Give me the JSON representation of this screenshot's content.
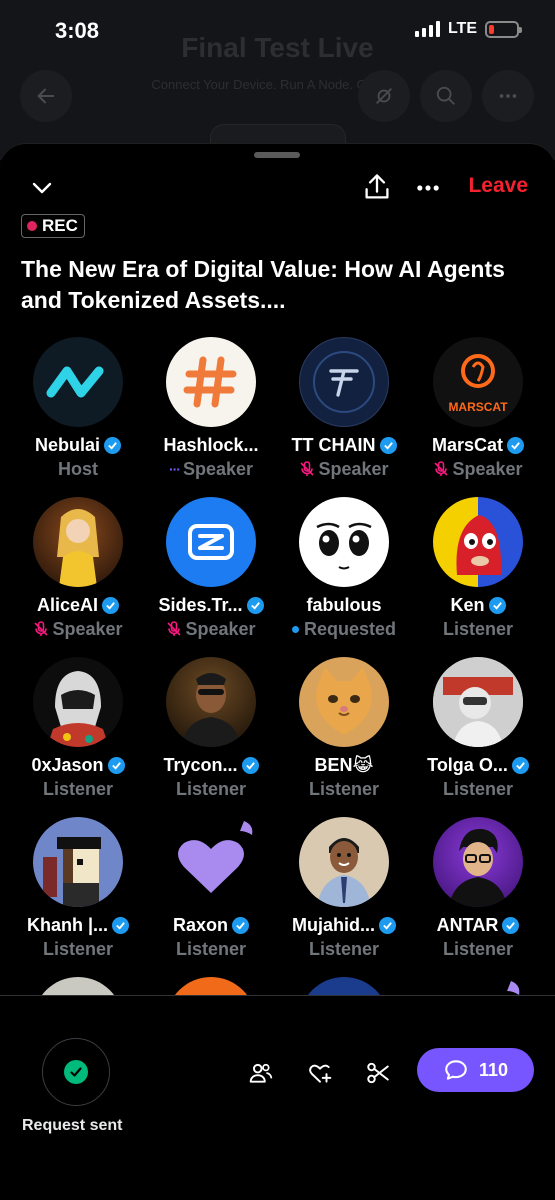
{
  "status_bar": {
    "time": "3:08",
    "network": "LTE"
  },
  "background": {
    "title": "Final Test Live",
    "subtitle": "Connect Your Device. Run A Node. Go ..ard"
  },
  "sheet": {
    "leave_label": "Leave",
    "rec_label": "REC",
    "title": "The New Era of Digital Value: How AI Agents and Tokenized Assets....",
    "participants": [
      {
        "name": "Nebulai",
        "role": "Host",
        "verified": true,
        "mic": "none"
      },
      {
        "name": "Hashlock...",
        "role": "Speaker",
        "verified": false,
        "mic": "speaking"
      },
      {
        "name": "TT CHAIN",
        "role": "Speaker",
        "verified": true,
        "mic": "muted"
      },
      {
        "name": "MarsCat",
        "role": "Speaker",
        "verified": true,
        "mic": "muted"
      },
      {
        "name": "AliceAI",
        "role": "Speaker",
        "verified": true,
        "mic": "muted"
      },
      {
        "name": "Sides.Tr...",
        "role": "Speaker",
        "verified": true,
        "mic": "muted"
      },
      {
        "name": "fabulous",
        "role": "Requested",
        "verified": false,
        "mic": "requested"
      },
      {
        "name": "Ken",
        "role": "Listener",
        "verified": true,
        "mic": "none"
      },
      {
        "name": "0xJason",
        "role": "Listener",
        "verified": true,
        "mic": "none"
      },
      {
        "name": "Trycon...",
        "role": "Listener",
        "verified": true,
        "mic": "none"
      },
      {
        "name": "BEN😹",
        "role": "Listener",
        "verified": false,
        "mic": "none"
      },
      {
        "name": "Tolga O...",
        "role": "Listener",
        "verified": true,
        "mic": "none"
      },
      {
        "name": "Khanh |...",
        "role": "Listener",
        "verified": true,
        "mic": "none"
      },
      {
        "name": "Raxon",
        "role": "Listener",
        "verified": true,
        "mic": "none"
      },
      {
        "name": "Mujahid...",
        "role": "Listener",
        "verified": true,
        "mic": "none"
      },
      {
        "name": "ANTAR",
        "role": "Listener",
        "verified": true,
        "mic": "none"
      }
    ]
  },
  "footer": {
    "request_label": "Request sent",
    "comment_count": "110"
  },
  "colors": {
    "accent": "#7856ff",
    "leave": "#f4212e",
    "verified": "#1d9bf0",
    "check": "#00ba7c"
  },
  "icons": [
    "chevron-down-icon",
    "share-icon",
    "more-icon",
    "verified-icon",
    "mic-off-icon",
    "checkmark-icon",
    "people-icon",
    "heart-plus-icon",
    "scissors-icon",
    "comment-icon"
  ]
}
